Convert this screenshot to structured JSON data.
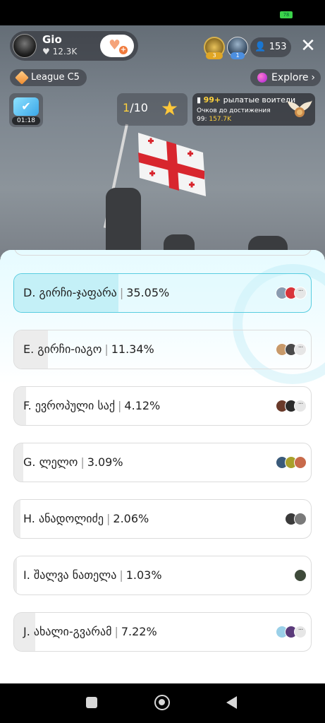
{
  "status_bar": {
    "battery": "78"
  },
  "host": {
    "name": "Gio",
    "likes": "12.3K",
    "follow_icon": "heart-plus-icon"
  },
  "viewers": {
    "top_gifter_badge": "3",
    "top_viewer_badge": "1",
    "count": "153"
  },
  "league": {
    "label": "League C5",
    "icon": "diamond-icon"
  },
  "explore": {
    "label": "Explore",
    "icon": "planet-icon"
  },
  "timer": {
    "time": "01:18"
  },
  "goal": {
    "current": "1",
    "total": "/10"
  },
  "achievement": {
    "level": "99+",
    "title": "рылатые воители",
    "subtitle": "Очков до достижения",
    "progress_prefix": "99:",
    "progress_value": "157.7K"
  },
  "poll": {
    "options": [
      {
        "letter": "D.",
        "name": "გირჩი-ჯაფარა",
        "percent": "35.05%",
        "fraction": 0.3505,
        "selected": true,
        "voter_colors": [
          "#8a9bb0",
          "#d8343a"
        ],
        "has_more": true
      },
      {
        "letter": "E.",
        "name": "გირჩი-იაგო",
        "percent": "11.34%",
        "fraction": 0.1134,
        "selected": false,
        "voter_colors": [
          "#c89a6a",
          "#4a4a4a"
        ],
        "has_more": true
      },
      {
        "letter": "F.",
        "name": "ევროპული საქ",
        "percent": "4.12%",
        "fraction": 0.0412,
        "selected": false,
        "voter_colors": [
          "#6a3a2a",
          "#2a2a2a"
        ],
        "has_more": true
      },
      {
        "letter": "G.",
        "name": "ლელო",
        "percent": "3.09%",
        "fraction": 0.0309,
        "selected": false,
        "voter_colors": [
          "#3a5a7a",
          "#a8a02a",
          "#c86a4a"
        ],
        "has_more": false
      },
      {
        "letter": "H.",
        "name": "ანადოლიძე",
        "percent": "2.06%",
        "fraction": 0.0206,
        "selected": false,
        "voter_colors": [
          "#3a3a3a",
          "#7a7a7a"
        ],
        "has_more": false
      },
      {
        "letter": "I.",
        "name": "შალვა ნათელა",
        "percent": "1.03%",
        "fraction": 0.0103,
        "selected": false,
        "voter_colors": [
          "#3e4a3a"
        ],
        "has_more": false
      },
      {
        "letter": "J.",
        "name": "ახალი-გვარამ",
        "percent": "7.22%",
        "fraction": 0.0722,
        "selected": false,
        "voter_colors": [
          "#9ad0e8",
          "#5a3a7a"
        ],
        "has_more": true
      }
    ]
  }
}
